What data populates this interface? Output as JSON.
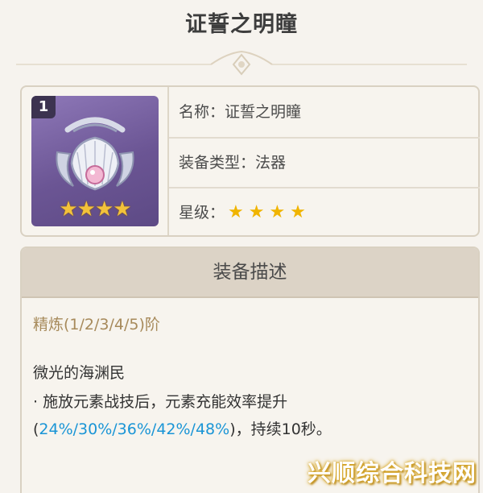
{
  "page_title": "证誓之明瞳",
  "item": {
    "refinement_badge": "1",
    "icon_stars": "★★★★",
    "name_label": "名称：",
    "name_value": "证誓之明瞳",
    "type_label": "装备类型：",
    "type_value": "法器",
    "rarity_label": "星级：",
    "rarity_stars": "★★★★",
    "rarity_value": 4
  },
  "description": {
    "header": "装备描述",
    "refinement_label": "精炼(1/2/3/4/5)阶",
    "effect_name": "微光的海渊民",
    "effect_prefix": "· 施放元素战技后，元素充能效率提升(",
    "effect_values": "24%/30%/36%/42%/48%",
    "effect_suffix": ")，持续10秒。"
  },
  "watermark": "兴顺综合科技网",
  "colors": {
    "highlight": "#1a95d6",
    "star": "#f0b400",
    "refine_label": "#a78a5b"
  }
}
